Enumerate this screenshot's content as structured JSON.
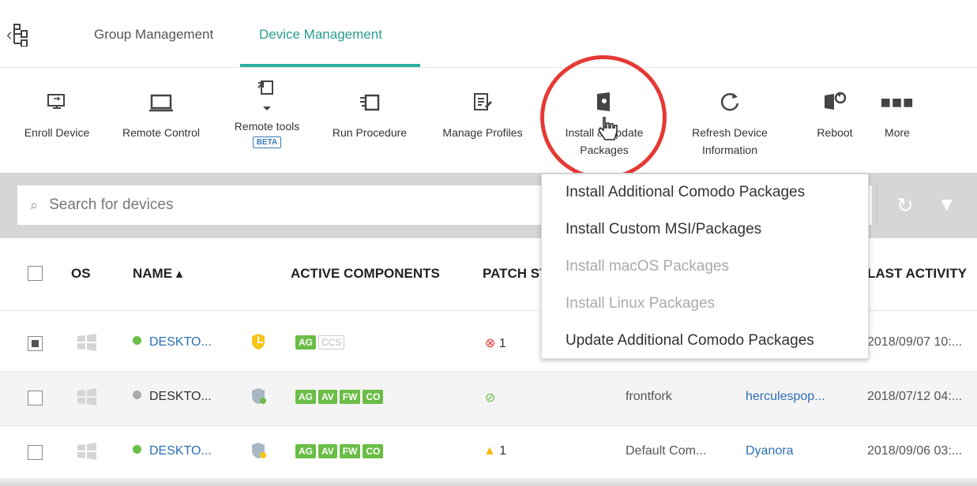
{
  "tabs": {
    "group": "Group Management",
    "device": "Device Management"
  },
  "toolbar": {
    "enroll": "Enroll Device",
    "remote_control": "Remote Control",
    "remote_tools": "Remote tools",
    "beta": "BETA",
    "run_procedure": "Run Procedure",
    "manage_profiles": "Manage Profiles",
    "install_line1": "Install & Update",
    "install_line2": "Packages",
    "refresh_line1": "Refresh Device",
    "refresh_line2": "Information",
    "reboot": "Reboot",
    "more": "More"
  },
  "search": {
    "placeholder": "Search for devices"
  },
  "table": {
    "headers": {
      "os": "OS",
      "name": "NAME ▴",
      "active_components": "ACTIVE COMPONENTS",
      "patch": "PATCH ST",
      "last_activity": "LAST ACTIVITY"
    },
    "rows": [
      {
        "name": "DESKTO...",
        "status_color": "#6abd45",
        "badges": [
          "AG"
        ],
        "badges_off": [
          "CCS"
        ],
        "patch": "1",
        "patch_icon": "error-icon",
        "customer": "",
        "user": "",
        "last_activity": "2018/09/07 10:..."
      },
      {
        "name": "DESKTO...",
        "status_color": "#aaaaaa",
        "badges": [
          "AG",
          "AV",
          "FW",
          "CO"
        ],
        "badges_off": [],
        "patch": "",
        "patch_icon": "ok-icon",
        "customer": "frontfork",
        "user": "herculespop...",
        "last_activity": "2018/07/12 04:..."
      },
      {
        "name": "DESKTO...",
        "status_color": "#6abd45",
        "badges": [
          "AG",
          "AV",
          "FW",
          "CO"
        ],
        "badges_off": [],
        "patch": "1",
        "patch_icon": "warning-icon",
        "customer": "Default Com...",
        "user": "Dyanora",
        "last_activity": "2018/09/06 03:..."
      }
    ]
  },
  "dropdown": {
    "items": [
      {
        "label": "Install Additional Comodo Packages",
        "disabled": false
      },
      {
        "label": "Install Custom MSI/Packages",
        "disabled": false
      },
      {
        "label": "Install macOS Packages",
        "disabled": true
      },
      {
        "label": "Install Linux Packages",
        "disabled": true
      },
      {
        "label": "Update Additional Comodo Packages",
        "disabled": false
      }
    ]
  },
  "colors": {
    "accent": "#2bb0a0",
    "highlight_circle": "#e53935",
    "link": "#2c6fb5",
    "badge": "#6abd45"
  }
}
